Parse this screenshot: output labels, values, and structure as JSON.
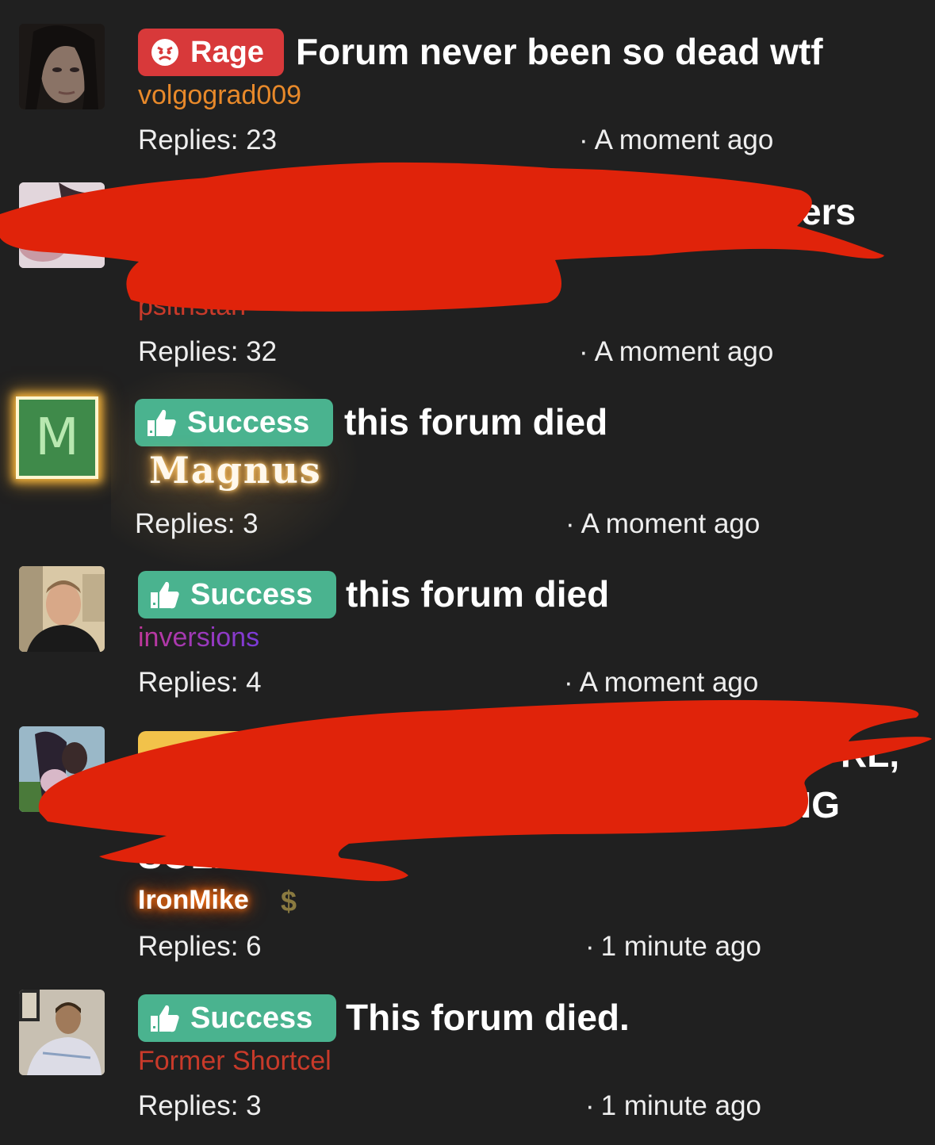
{
  "threads": [
    {
      "badge": "Rage",
      "title": "Forum never been so dead wtf",
      "author": "volgograd009",
      "replies": "Replies: 23",
      "time": "A moment ago",
      "avatar_icon": "girl-portrait-avatar"
    },
    {
      "title_fragment": "ers",
      "author": "psltristan",
      "replies": "Replies: 32",
      "time": "A moment ago",
      "avatar_icon": "user-avatar-photo"
    },
    {
      "badge": "Success",
      "title": "this forum died",
      "author": "Magnus",
      "avatar_letter": "M",
      "replies": "Replies: 3",
      "time": "A moment ago"
    },
    {
      "badge": "Success",
      "title": "this forum died",
      "author": "inversions",
      "replies": "Replies: 4",
      "time": "A moment ago",
      "avatar_icon": "man-portrait-avatar"
    },
    {
      "title_fragment_1": "RL,",
      "title_fragment_2": "NG",
      "title_fragment_3": "SOLDIERS",
      "author": "IronMike",
      "author_badge": "$",
      "replies": "Replies: 6",
      "time": "1 minute ago",
      "avatar_icon": "anime-art-avatar"
    },
    {
      "badge": "Success",
      "title": "This forum died.",
      "author": "Former Shortcel",
      "replies": "Replies: 3",
      "time": "1 minute ago",
      "avatar_icon": "man-hospital-avatar"
    }
  ],
  "colors": {
    "background": "#202020",
    "rage_badge": "#d8393a",
    "success_badge": "#4ab38f",
    "author_orange": "#e8892a",
    "author_red": "#c83a2a",
    "author_purple": "#9b3bd6",
    "redaction": "#e0230a",
    "magnus_avatar": "#3f8a4a"
  }
}
